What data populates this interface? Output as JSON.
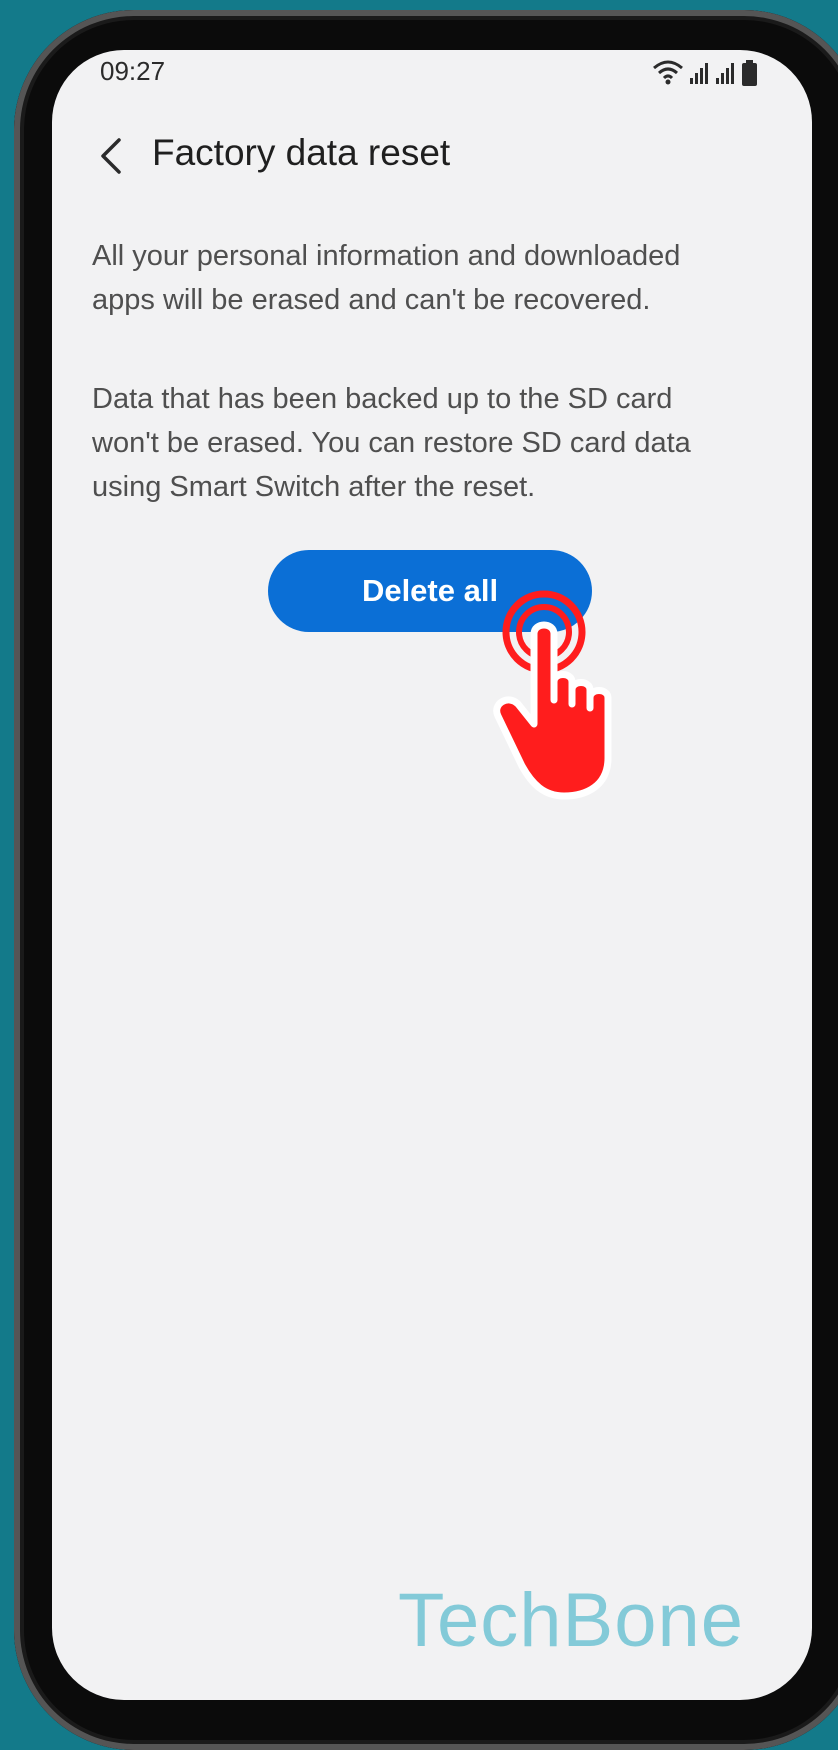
{
  "status_bar": {
    "time": "09:27",
    "icons": [
      "wifi-icon",
      "signal-icon",
      "signal-icon",
      "battery-icon"
    ]
  },
  "header": {
    "back_icon": "chevron-left-icon",
    "title": "Factory data reset"
  },
  "body": {
    "paragraph_1": "All your personal information and downloaded apps will be erased and can't be recovered.",
    "paragraph_2": "Data that has been backed up to the SD card won't be erased. You can restore SD card data using Smart Switch after the reset."
  },
  "actions": {
    "delete_all_label": "Delete all"
  },
  "overlay": {
    "pointer_icon": "tap-hand-icon",
    "watermark": "TechBone"
  },
  "colors": {
    "background": "#137a8a",
    "screen": "#f2f2f3",
    "primary_button": "#0b6fd6",
    "pointer": "#ff1d1d",
    "watermark": "#7ec8d7"
  }
}
